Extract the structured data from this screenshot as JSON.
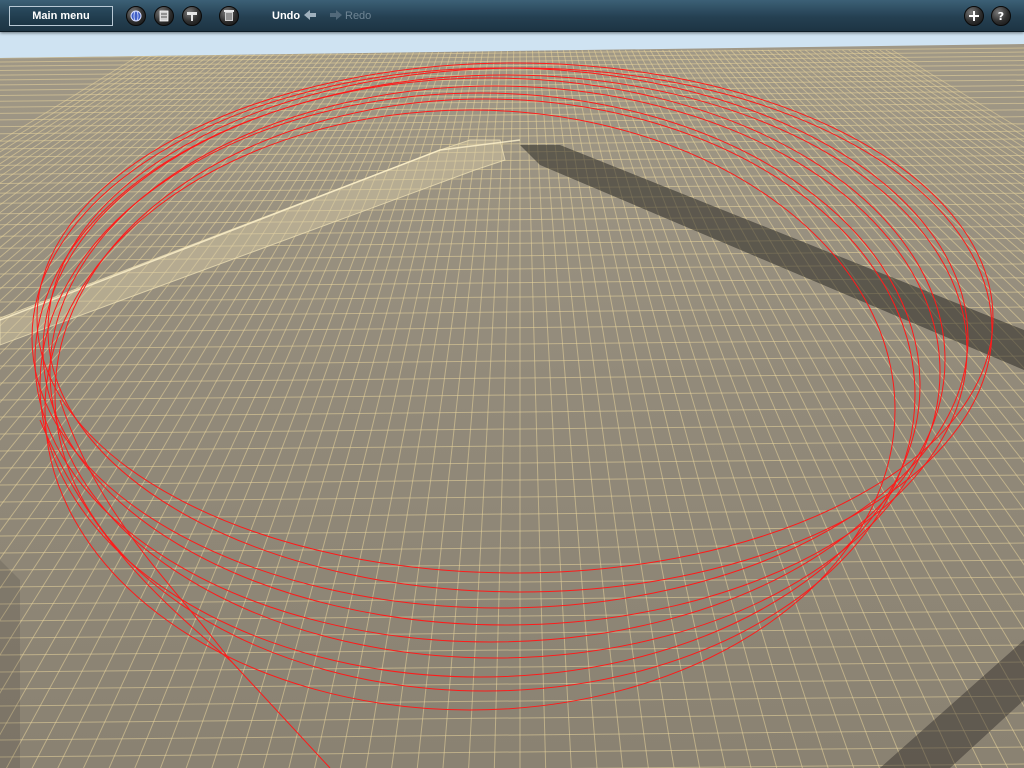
{
  "toolbar": {
    "main_menu_label": "Main menu",
    "undo_label": "Undo",
    "redo_label": "Redo",
    "tools": [
      {
        "name": "globe-icon"
      },
      {
        "name": "layers-icon"
      },
      {
        "name": "paint-icon"
      },
      {
        "name": "trash-icon"
      }
    ],
    "right_buttons": [
      {
        "name": "add-icon"
      },
      {
        "name": "help-icon"
      }
    ]
  },
  "viewport": {
    "terrain_color": "#8f8777",
    "grid_color": "#e8d49a",
    "spline_color": "#ff1a1a"
  }
}
